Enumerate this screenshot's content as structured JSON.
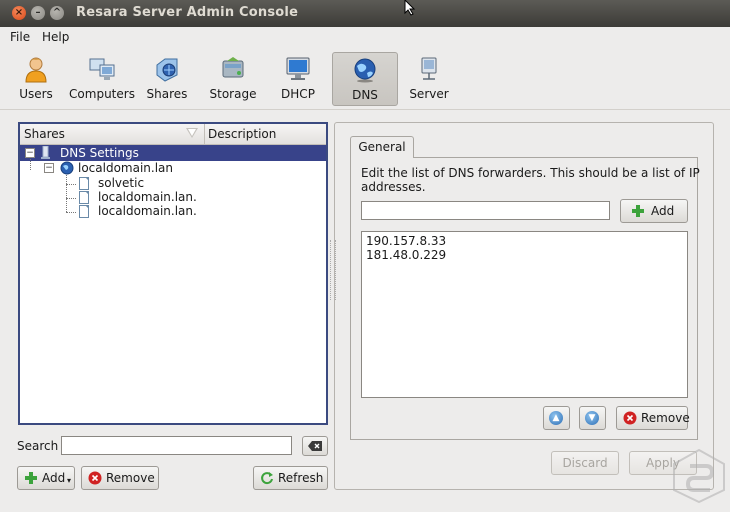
{
  "window": {
    "title": "Resara Server Admin Console"
  },
  "menu": [
    {
      "label": "File"
    },
    {
      "label": "Help"
    }
  ],
  "toolbar": {
    "items": [
      {
        "label": "Users",
        "icon": "user-icon"
      },
      {
        "label": "Computers",
        "icon": "computers-icon"
      },
      {
        "label": "Shares",
        "icon": "shares-icon"
      },
      {
        "label": "Storage",
        "icon": "storage-icon"
      },
      {
        "label": "DHCP",
        "icon": "monitor-icon"
      },
      {
        "label": "DNS",
        "icon": "globe-icon"
      },
      {
        "label": "Server",
        "icon": "server-icon"
      }
    ],
    "active": "DNS"
  },
  "tree": {
    "columns": [
      "Shares",
      "Description"
    ],
    "nodes": [
      {
        "label": "DNS Settings",
        "selected": true
      },
      {
        "label": "localdomain.lan"
      },
      {
        "label": "solvetic"
      },
      {
        "label": "localdomain.lan."
      },
      {
        "label": "localdomain.lan."
      }
    ]
  },
  "left_actions": {
    "search_label": "Search",
    "search_value": "",
    "add_label": "Add",
    "remove_label": "Remove",
    "refresh_label": "Refresh"
  },
  "settings": {
    "tab_label": "General",
    "description": "Edit the list of DNS forwarders. This should be a list of IP addresses.",
    "forwarder_input_value": "",
    "add_label": "Add",
    "forwarders": [
      "190.157.8.33",
      "181.48.0.229"
    ],
    "remove_label": "Remove",
    "discard_label": "Discard",
    "apply_label": "Apply"
  },
  "colors": {
    "titlebar": "#3c3b37",
    "selection": "#38438a",
    "window_bg": "#edeceb"
  }
}
